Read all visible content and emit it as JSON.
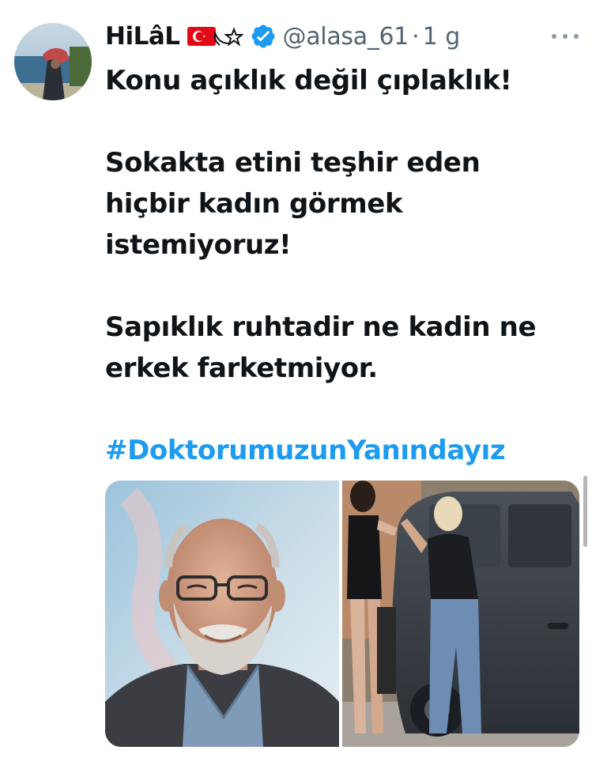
{
  "author": {
    "display_name": "HiLâL",
    "handle": "@alasa_61",
    "separator": "·",
    "time": "1 g",
    "verified_icon": "verified-badge-icon",
    "flags": [
      "turkish-flag-icon",
      "star-outline-icon"
    ]
  },
  "tweet": {
    "paragraphs": [
      "Konu açıklık değil çıplaklık!",
      "Sokakta etini teşhir eden hiçbir kadın görmek istemiyoruz!",
      "Sapıklık ruhtadir ne kadin ne erkek farketmiyor."
    ],
    "hashtag": "#DoktorumuzunYanındayız"
  },
  "media": {
    "count": 2,
    "items": [
      "photo-of-smiling-bearded-man",
      "photo-of-street-altercation-near-car"
    ]
  },
  "colors": {
    "text": "#0f1419",
    "secondary": "#536471",
    "accent": "#1d9bf0",
    "flag_red": "#e30a17"
  }
}
